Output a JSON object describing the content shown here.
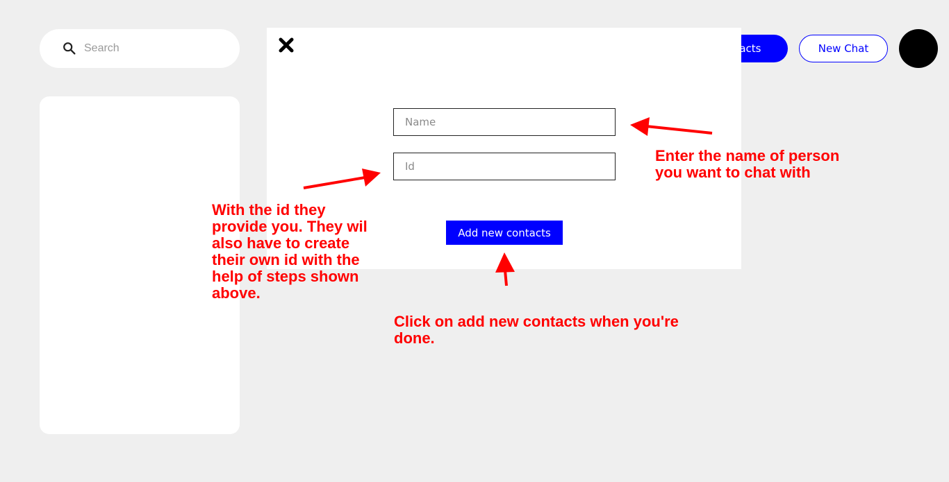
{
  "search": {
    "placeholder": "Search"
  },
  "header": {
    "contacts_button_label": "tacts",
    "new_chat_label": "New Chat"
  },
  "modal": {
    "name_placeholder": "Name",
    "id_placeholder": "Id",
    "add_button_label": "Add new contacts"
  },
  "annotations": {
    "name_hint": "Enter the name of person you want to chat with",
    "id_hint": "With the id they provide you. They wil also have to create their own id with the help of steps shown above.",
    "add_hint": "Click on add new contacts when you're done."
  },
  "colors": {
    "background": "#efefef",
    "accent": "#0000ff",
    "annotation": "#ff0000"
  }
}
